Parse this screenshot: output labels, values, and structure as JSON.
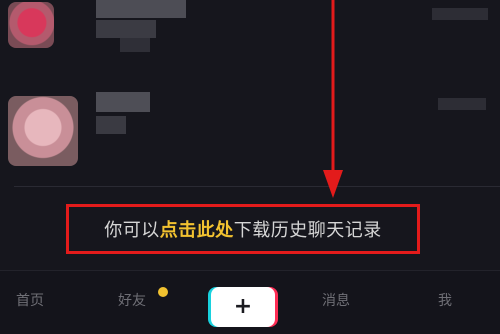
{
  "history_prompt": {
    "prefix": "你可以",
    "link": "点击此处",
    "suffix": "下载历史聊天记录"
  },
  "tabbar": {
    "home": "首页",
    "friends": "好友",
    "add": "+",
    "messages": "消息",
    "me": "我"
  },
  "colors": {
    "background": "#16161d",
    "annotation_red": "#e31b1b",
    "link_yellow": "#f2c230",
    "badge_yellow": "#f2c230"
  }
}
